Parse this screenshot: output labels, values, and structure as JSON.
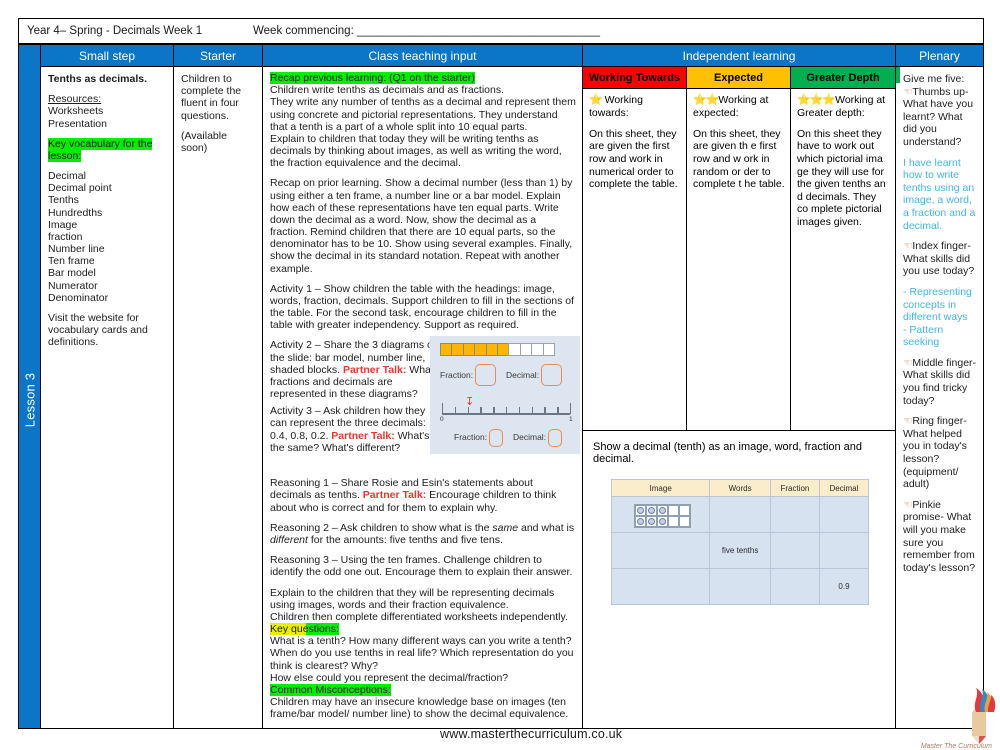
{
  "header": {
    "title": "Year 4– Spring - Decimals Week 1",
    "week_commencing_label": "Week commencing: ______________________________________"
  },
  "spine": {
    "lesson_label": "Lesson 3"
  },
  "columns": {
    "small_step": "Small step",
    "starter": "Starter",
    "class_teaching_input": "Class teaching input",
    "independent_learning": "Independent learning",
    "plenary": "Plenary"
  },
  "small_step": {
    "title": "Tenths as decimals.",
    "resources_label": "Resources:",
    "resources": [
      "Worksheets",
      "Presentation"
    ],
    "key_vocab_label": "Key vocabulary for the lesson:",
    "vocabulary": [
      "Decimal",
      "Decimal point",
      "Tenths",
      "Hundredths",
      "Image",
      "fraction",
      "Number line",
      "Ten frame",
      "Bar model",
      "Numerator",
      "Denominator"
    ],
    "footer_note": "Visit the website for vocabulary cards and definitions."
  },
  "starter": {
    "line1": "Children to complete the fluent in four questions.",
    "line2": "(Available soon)"
  },
  "teaching": {
    "recap_heading": "Recap previous learning: (Q1 on the starter)",
    "para1": "Children write tenths as decimals and as fractions.",
    "para2": "They write any number of tenths as a decimal and represent them using concrete and pictorial representations. They understand that a tenth is a part of a whole split into 10 equal parts.",
    "para3": "Explain to children that today they will be writing tenths as decimals by thinking about images, as well as writing the word, the fraction equivalence and the decimal.",
    "para4": "Recap on prior learning. Show a decimal number (less than 1) by using either a ten frame, a number line or a bar model. Explain how each of these representations have ten equal parts. Write down the decimal as a word.  Now, show the decimal as a fraction. Remind children that there are 10 equal parts, so the denominator has to be 10. Show using several examples. Finally, show the decimal in its standard notation. Repeat with another example.",
    "activity1": "Activity 1 – Show children the table with the headings: image, words, fraction, decimals. Support children to fill in the sections of the table. For the second task, encourage children to fill in the table with greater independency. Support as required.",
    "activity2_pre": "Activity 2 – Share the 3 diagrams on the slide: bar model, number line, shaded blocks. ",
    "activity2_partner": "Partner Talk:",
    "activity2_post": " What fractions and decimals are represented in these diagrams?",
    "activity3_pre": "Activity 3 – Ask children how they can represent the three decimals: 0.4, 0.8, 0.2. ",
    "activity3_partner": "Partner Talk:",
    "activity3_post": " What's the same? What's different?",
    "reasoning1_pre": "Reasoning 1 – Share Rosie and Esin's statements about decimals as tenths. ",
    "reasoning1_partner": "Partner Talk:",
    "reasoning1_post": " Encourage children to think about who is correct and for them to explain why.",
    "reasoning2_a": "Reasoning 2 – Ask children to show what is the ",
    "reasoning2_same": "same",
    "reasoning2_b": " and what is ",
    "reasoning2_different": "different",
    "reasoning2_c": " for the amounts:  five tenths and five tens.",
    "reasoning3": "Reasoning 3 – Using the ten frames. Challenge children to identify the odd one out. Encourage them to explain their answer.",
    "explain": "Explain to the children that they will be representing decimals using images, words and their fraction equivalence.",
    "worksheets": "Children then complete differentiated worksheets independently.",
    "key_questions_label": "Key questions:",
    "key_questions": [
      "What is a tenth? How many different ways can you write a tenth?",
      "When do you use tenths in real life? Which representation do you think is clearest? Why?",
      "How else could you represent the decimal/fraction?"
    ],
    "misconceptions_label": "Common Misconceptions:",
    "misconceptions": "Children may have an insecure knowledge base on images (ten frame/bar model/ number line) to show the decimal equivalence.",
    "bar_model": {
      "total_cells": 10,
      "shaded_cells": 6,
      "fraction_label": "Fraction:",
      "decimal_label": "Decimal:"
    },
    "number_line": {
      "start_label": "0",
      "end_label": "1",
      "divisions": 10,
      "marker_position": 0.2,
      "fraction_label": "Fraction:",
      "decimal_label": "Decimal:"
    }
  },
  "independent": {
    "levels": [
      {
        "name": "Working Towards",
        "color": "#ff0000",
        "stars": 1,
        "heading": "Working towards:",
        "body": "On this sheet, they are given the first row and work in numerical order to complete the table."
      },
      {
        "name": "Expected",
        "color": "#ffc000",
        "stars": 2,
        "heading": "Working at expected:",
        "body": "On this sheet, they are given th e first row and w ork in random or der to complete t he table."
      },
      {
        "name": "Greater Depth",
        "color": "#00b050",
        "stars": 3,
        "heading": "Working at Greater depth:",
        "body": "On this sheet they have to work out which pictorial ima ge they will use for the given tenths an d decimals. They co mplete pictorial images given."
      }
    ],
    "task_caption": "Show a decimal (tenth) as an image, word, fraction and decimal.",
    "table": {
      "headers": [
        "Image",
        "Words",
        "Fraction",
        "Decimal"
      ],
      "rows": [
        {
          "image": "ten-frame-6",
          "words": "",
          "fraction": "",
          "decimal": ""
        },
        {
          "image": "",
          "words": "five tenths",
          "fraction": "",
          "decimal": ""
        },
        {
          "image": "",
          "words": "",
          "fraction": "",
          "decimal": "0.9"
        }
      ]
    }
  },
  "plenary": {
    "intro": "Give me five:",
    "items": [
      {
        "icon": "hand-icon",
        "text": "Thumbs up- What have you learnt? What did you understand?"
      },
      {
        "icon": "hand-icon",
        "text": "Index finger- What skills did you use today?"
      },
      {
        "icon": "hand-icon",
        "text": "Middle finger- What skills did you find tricky today?"
      },
      {
        "icon": "hand-icon",
        "text": "Ring finger- What helped you in today's lesson? (equipment/ adult)"
      },
      {
        "icon": "hand-icon",
        "text": "Pinkie promise- What will you make sure you remember from today's lesson?"
      }
    ],
    "answer1": "I have learnt how to write tenths using an image, a word, a fraction and a decimal.",
    "answer2_line1": "- Representing concepts in different ways",
    "answer2_line2": "- Pattern seeking"
  },
  "footer": {
    "url": "www.masterthecurriculum.co.uk",
    "logo_text": "Master  The  Curriculum"
  },
  "colors": {
    "header_blue": "#0b76c8",
    "working_towards": "#ff0000",
    "expected": "#ffc000",
    "greater_depth": "#00b050",
    "highlight_green": "#00ee00",
    "partner_talk_red": "#e8372b",
    "answer_cyan": "#41b6e6"
  }
}
